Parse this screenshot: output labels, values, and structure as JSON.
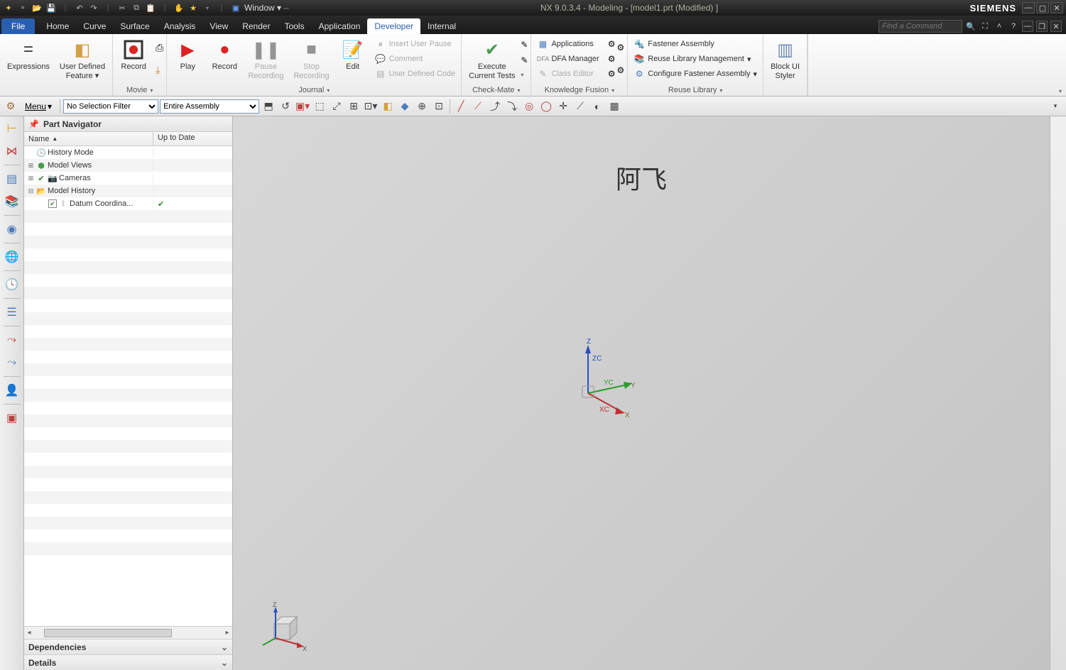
{
  "title": "NX 9.0.3.4 - Modeling - [model1.prt (Modified) ]",
  "brand": "SIEMENS",
  "qat_window_label": "Window",
  "search_placeholder": "Find a Command",
  "menu": {
    "file": "File",
    "tabs": [
      "Home",
      "Curve",
      "Surface",
      "Analysis",
      "View",
      "Render",
      "Tools",
      "Application",
      "Developer",
      "Internal"
    ],
    "active": "Developer"
  },
  "ribbon": {
    "g1": {
      "expressions": "Expressions",
      "udf": "User Defined\nFeature"
    },
    "g2": {
      "record": "Record",
      "play": "Play",
      "pause": "Pause\nRecording",
      "stop": "Stop\nRecording",
      "label": "Movie"
    },
    "g3": {
      "edit": "Edit",
      "insert_pause": "Insert User Pause",
      "comment": "Comment",
      "udc": "User Defined Code",
      "label": "Journal"
    },
    "g4": {
      "exec": "Execute\nCurrent Tests",
      "label": "Check-Mate"
    },
    "g5": {
      "apps": "Applications",
      "dfa": "DFA Manager",
      "class_editor": "Class Editor",
      "label": "Knowledge Fusion"
    },
    "g6": {
      "fast": "Fastener Assembly",
      "reuse_mgmt": "Reuse Library Management",
      "config_fast": "Configure Fastener Assembly",
      "label": "Reuse Library"
    },
    "g7": {
      "block": "Block UI\nStyler"
    }
  },
  "toolbar2": {
    "menu_label": "Menu",
    "filter1": "No Selection Filter",
    "filter2": "Entire Assembly"
  },
  "nav": {
    "title": "Part Navigator",
    "col_name": "Name",
    "col_uptodate": "Up to Date",
    "items": {
      "history_mode": "History Mode",
      "model_views": "Model Views",
      "cameras": "Cameras",
      "model_history": "Model History",
      "datum": "Datum Coordina..."
    },
    "dependencies": "Dependencies",
    "details": "Details"
  },
  "viewport": {
    "watermark": "阿飞",
    "axes": {
      "x": "X",
      "y": "Y",
      "z": "Z",
      "xc": "XC",
      "yc": "YC",
      "zc": "ZC"
    }
  }
}
